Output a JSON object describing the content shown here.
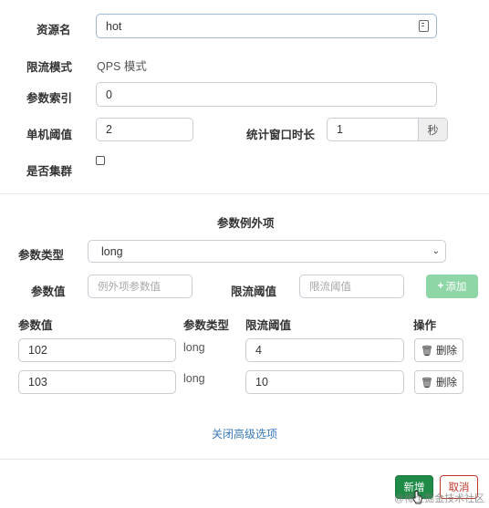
{
  "form": {
    "resource_label": "资源名",
    "resource_value": "hot",
    "mode_label": "限流模式",
    "mode_value": "QPS 模式",
    "param_index_label": "参数索引",
    "param_index_value": "0",
    "threshold_label": "单机阈值",
    "threshold_value": "2",
    "window_label": "统计窗口时长",
    "window_value": "1",
    "window_unit": "秒",
    "cluster_label": "是否集群"
  },
  "exceptions": {
    "title": "参数例外项",
    "param_type_label": "参数类型",
    "param_type_value": "long",
    "param_value_label": "参数值",
    "param_value_placeholder": "例外项参数值",
    "limit_label": "限流阈值",
    "limit_placeholder": "限流阈值",
    "add_label": "添加",
    "table_headers": {
      "param_value": "参数值",
      "param_type": "参数类型",
      "limit": "限流阈值",
      "actions": "操作"
    },
    "rows": [
      {
        "value": "102",
        "type": "long",
        "limit": "4",
        "delete_label": "删除"
      },
      {
        "value": "103",
        "type": "long",
        "limit": "10",
        "delete_label": "删除"
      }
    ]
  },
  "close_advanced_label": "关闭高级选项",
  "footer": {
    "save_label": "新增",
    "cancel_label": "取消"
  },
  "watermark": "@稀土掘金技术社区"
}
